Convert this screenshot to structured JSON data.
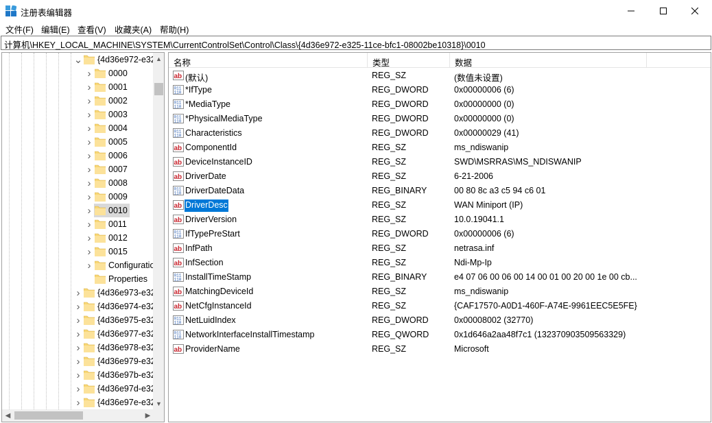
{
  "window": {
    "title": "注册表编辑器",
    "accent": "#0078d7"
  },
  "menu": [
    "文件(F)",
    "编辑(E)",
    "查看(V)",
    "收藏夹(A)",
    "帮助(H)"
  ],
  "address": "计算机\\HKEY_LOCAL_MACHINE\\SYSTEM\\CurrentControlSet\\Control\\Class\\{4d36e972-e325-11ce-bfc1-08002be10318}\\0010",
  "tree": {
    "parent": "{4d36e972-e32",
    "children": [
      "0000",
      "0001",
      "0002",
      "0003",
      "0004",
      "0005",
      "0006",
      "0007",
      "0008",
      "0009",
      "0010",
      "0011",
      "0012",
      "0015",
      "Configuratio",
      "Properties"
    ],
    "selected": "0010",
    "siblings": [
      "{4d36e973-e32",
      "{4d36e974-e32",
      "{4d36e975-e32",
      "{4d36e977-e32",
      "{4d36e978-e32",
      "{4d36e979-e32",
      "{4d36e97b-e32",
      "{4d36e97d-e32",
      "{4d36e97e-e32"
    ]
  },
  "columns": {
    "name": "名称",
    "type": "类型",
    "data": "数据"
  },
  "values": [
    {
      "icon": "string",
      "name": "(默认)",
      "type": "REG_SZ",
      "data": "(数值未设置)"
    },
    {
      "icon": "binary",
      "name": "*IfType",
      "type": "REG_DWORD",
      "data": "0x00000006 (6)"
    },
    {
      "icon": "binary",
      "name": "*MediaType",
      "type": "REG_DWORD",
      "data": "0x00000000 (0)"
    },
    {
      "icon": "binary",
      "name": "*PhysicalMediaType",
      "type": "REG_DWORD",
      "data": "0x00000000 (0)"
    },
    {
      "icon": "binary",
      "name": "Characteristics",
      "type": "REG_DWORD",
      "data": "0x00000029 (41)"
    },
    {
      "icon": "string",
      "name": "ComponentId",
      "type": "REG_SZ",
      "data": "ms_ndiswanip"
    },
    {
      "icon": "string",
      "name": "DeviceInstanceID",
      "type": "REG_SZ",
      "data": "SWD\\MSRRAS\\MS_NDISWANIP"
    },
    {
      "icon": "string",
      "name": "DriverDate",
      "type": "REG_SZ",
      "data": "6-21-2006"
    },
    {
      "icon": "binary",
      "name": "DriverDateData",
      "type": "REG_BINARY",
      "data": "00 80 8c a3 c5 94 c6 01"
    },
    {
      "icon": "string",
      "name": "DriverDesc",
      "type": "REG_SZ",
      "data": "WAN Miniport (IP)",
      "selected": true
    },
    {
      "icon": "string",
      "name": "DriverVersion",
      "type": "REG_SZ",
      "data": "10.0.19041.1"
    },
    {
      "icon": "binary",
      "name": "IfTypePreStart",
      "type": "REG_DWORD",
      "data": "0x00000006 (6)"
    },
    {
      "icon": "string",
      "name": "InfPath",
      "type": "REG_SZ",
      "data": "netrasa.inf"
    },
    {
      "icon": "string",
      "name": "InfSection",
      "type": "REG_SZ",
      "data": "Ndi-Mp-Ip"
    },
    {
      "icon": "binary",
      "name": "InstallTimeStamp",
      "type": "REG_BINARY",
      "data": "e4 07 06 00 06 00 14 00 01 00 20 00 1e 00 cb..."
    },
    {
      "icon": "string",
      "name": "MatchingDeviceId",
      "type": "REG_SZ",
      "data": "ms_ndiswanip"
    },
    {
      "icon": "string",
      "name": "NetCfgInstanceId",
      "type": "REG_SZ",
      "data": "{CAF17570-A0D1-460F-A74E-9961EEC5E5FE}"
    },
    {
      "icon": "binary",
      "name": "NetLuidIndex",
      "type": "REG_DWORD",
      "data": "0x00008002 (32770)"
    },
    {
      "icon": "binary",
      "name": "NetworkInterfaceInstallTimestamp",
      "type": "REG_QWORD",
      "data": "0x1d646a2aa48f7c1 (132370903509563329)"
    },
    {
      "icon": "string",
      "name": "ProviderName",
      "type": "REG_SZ",
      "data": "Microsoft"
    }
  ]
}
